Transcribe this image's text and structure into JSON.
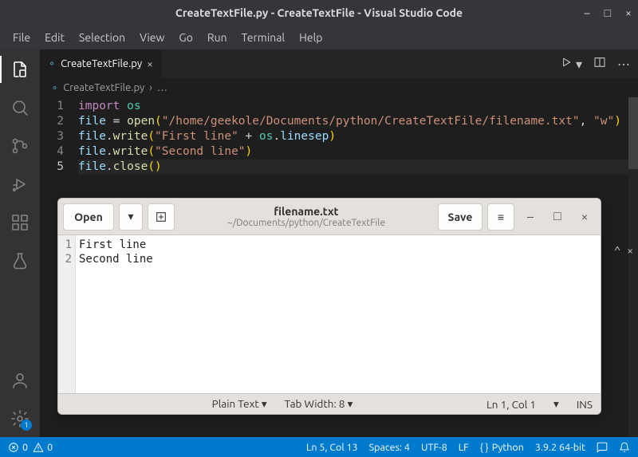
{
  "window": {
    "title": "CreateTextFile.py - CreateTextFile - Visual Studio Code"
  },
  "menubar": [
    "File",
    "Edit",
    "Selection",
    "View",
    "Go",
    "Run",
    "Terminal",
    "Help"
  ],
  "activitybar": {
    "settings_badge": "1"
  },
  "tab": {
    "filename": "CreateTextFile.py"
  },
  "breadcrumb": {
    "filename": "CreateTextFile.py",
    "sep": "›",
    "more": "…"
  },
  "code": {
    "line_numbers": [
      "1",
      "2",
      "3",
      "4",
      "5"
    ],
    "l1_import": "import",
    "l1_os": "os",
    "l2_file": "file",
    "l2_eq": " = ",
    "l2_open": "open",
    "l2_p1": "(",
    "l2_str": "\"/home/geekole/Documents/python/CreateTextFile/filename.txt\"",
    "l2_c": ", ",
    "l2_mode": "\"w\"",
    "l2_p2": ")",
    "l3_file": "file",
    "l3_dot": ".",
    "l3_write": "write",
    "l3_p1": "(",
    "l3_str": "\"First line\"",
    "l3_plus": " + ",
    "l3_os": "os",
    "l3_dot2": ".",
    "l3_linesep": "linesep",
    "l3_p2": ")",
    "l4_file": "file",
    "l4_dot": ".",
    "l4_write": "write",
    "l4_p1": "(",
    "l4_str": "\"Second line\"",
    "l4_p2": ")",
    "l5_file": "file",
    "l5_dot": ".",
    "l5_close": "close",
    "l5_p1": "(",
    "l5_p2": ")"
  },
  "gedit": {
    "open": "Open",
    "save": "Save",
    "title": "filename.txt",
    "subtitle": "~/Documents/python/CreateTextFile",
    "ln1_num": "1",
    "ln2_num": "2",
    "ln1": "First line",
    "ln2": "Second line",
    "status_plain": "Plain Text ▾",
    "status_tab": "Tab Width: 8 ▾",
    "status_pos": "Ln 1, Col 1",
    "status_pos_arrow": "▾",
    "status_ins": "INS"
  },
  "statusbar": {
    "errors": "0",
    "warnings": "0",
    "lncol": "Ln 5, Col 13",
    "spaces": "Spaces: 4",
    "encoding": "UTF-8",
    "eol": "LF",
    "lang": "Python",
    "interp": "3.9.2 64-bit"
  }
}
